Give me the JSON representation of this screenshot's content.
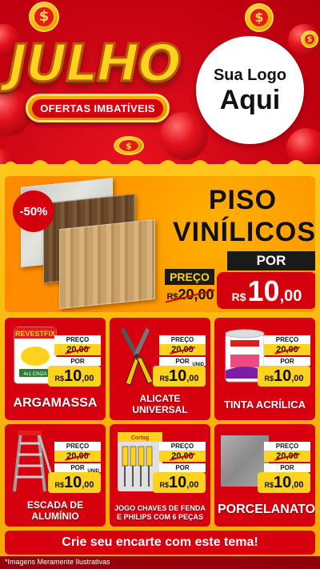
{
  "header": {
    "title": "JULHO",
    "ribbon": "OFERTAS IMBATÍVEIS",
    "logo_line1": "Sua Logo",
    "logo_line2": "Aqui",
    "coin_symbol": "$"
  },
  "hero": {
    "discount": "-50%",
    "title_line1": "PISO",
    "title_line2": "VINÍLICOS",
    "preco_label": "PREÇO",
    "old_currency": "R$",
    "old_price": "20,00",
    "por_label": "POR",
    "currency": "R$",
    "price_int": "10",
    "price_dec": ",00"
  },
  "products": [
    {
      "name": "ARGAMASSA",
      "preco_label": "PREÇO",
      "old_price": "20,00",
      "por_label": "POR",
      "currency": "R$",
      "price_int": "10",
      "price_dec": ",00",
      "unit": "",
      "brand": "REVESTFIX",
      "pack_text": "4x1 CINZA"
    },
    {
      "name_line1": "ALICATE",
      "name_line2": "UNIVERSAL",
      "preco_label": "PREÇO",
      "old_price": "20,00",
      "por_label": "POR",
      "currency": "R$",
      "price_int": "10",
      "price_dec": ",00",
      "unit": "UNID"
    },
    {
      "name": "TINTA ACRÍLICA",
      "preco_label": "PREÇO",
      "old_price": "20,00",
      "por_label": "POR",
      "currency": "R$",
      "price_int": "10",
      "price_dec": ",00",
      "unit": "",
      "brand": "quartzolit",
      "pack_text": "renda mais"
    },
    {
      "name_line1": "ESCADA DE",
      "name_line2": "ALUMÍNIO",
      "preco_label": "PREÇO",
      "old_price": "20,00",
      "por_label": "POR",
      "currency": "R$",
      "price_int": "10",
      "price_dec": ",00",
      "unit": "UNID"
    },
    {
      "name_line1": "JOGO CHAVES DE FENDA",
      "name_line2": "E PHILIPS COM 6 PEÇAS",
      "preco_label": "PREÇO",
      "old_price": "20,00",
      "por_label": "POR",
      "currency": "R$",
      "price_int": "10",
      "price_dec": ",00",
      "unit": "",
      "brand": "Cortag"
    },
    {
      "name": "PORCELANATO",
      "preco_label": "PREÇO",
      "old_price": "20,00",
      "por_label": "POR",
      "currency": "R$",
      "price_int": "10",
      "price_dec": ",00",
      "unit": ""
    }
  ],
  "cta": "Crie seu encarte com este tema!",
  "footnote": "*Imagens Meramente Ilustrativas",
  "colors": {
    "red": "#d6000f",
    "yellow": "#ffd21e",
    "orange": "#ff8c00"
  }
}
